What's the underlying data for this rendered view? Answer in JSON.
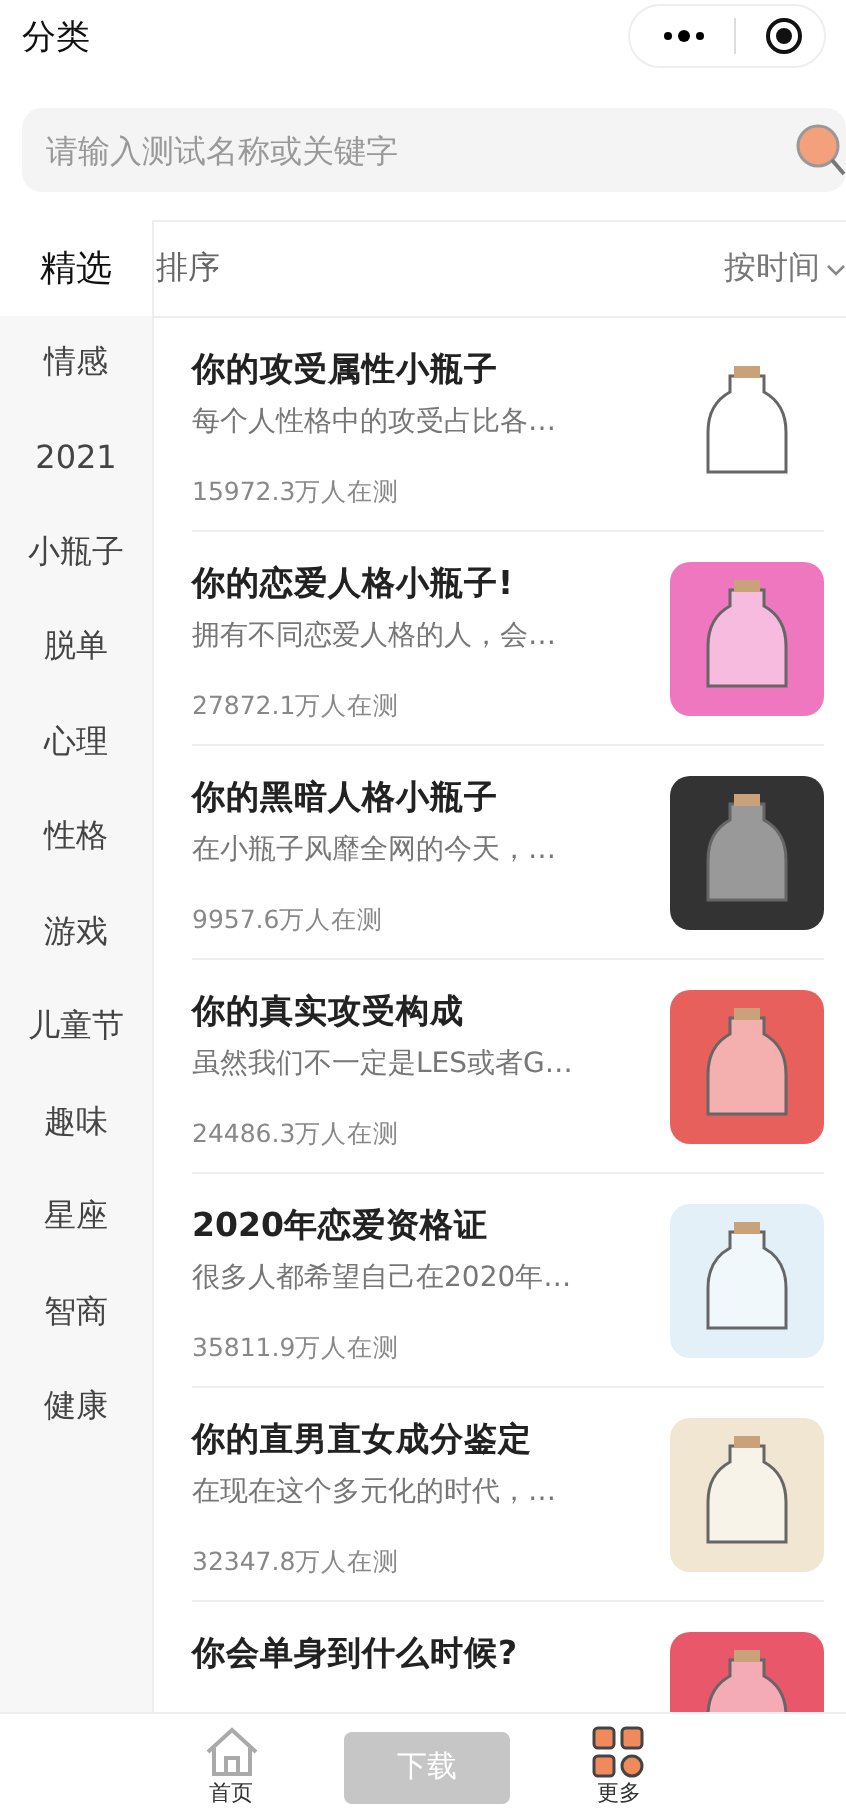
{
  "header": {
    "title": "分类"
  },
  "search": {
    "placeholder": "请输入测试名称或关键字"
  },
  "sidebar": {
    "items": [
      {
        "label": "精选",
        "selected": true
      },
      {
        "label": "情感",
        "selected": false
      },
      {
        "label": "2021",
        "selected": false
      },
      {
        "label": "小瓶子",
        "selected": false
      },
      {
        "label": "脱单",
        "selected": false
      },
      {
        "label": "心理",
        "selected": false
      },
      {
        "label": "性格",
        "selected": false
      },
      {
        "label": "游戏",
        "selected": false
      },
      {
        "label": "儿童节",
        "selected": false
      },
      {
        "label": "趣味",
        "selected": false
      },
      {
        "label": "星座",
        "selected": false
      },
      {
        "label": "智商",
        "selected": false
      },
      {
        "label": "健康",
        "selected": false
      }
    ]
  },
  "sort_bar": {
    "label": "排序",
    "order": "按时间"
  },
  "tests": [
    {
      "title": "你的攻受属性小瓶子",
      "description": "每个人性格中的攻受占比各…",
      "count": "15972.3万人在测"
    },
    {
      "title": "你的恋爱人格小瓶子!",
      "description": "拥有不同恋爱人格的人，会…",
      "count": "27872.1万人在测",
      "color": "#ef77bf"
    },
    {
      "title": "你的黑暗人格小瓶子",
      "description": "在小瓶子风靡全网的今天，…",
      "count": "9957.6万人在测",
      "color": "#333333"
    },
    {
      "title": "你的真实攻受构成",
      "description": "虽然我们不一定是LES或者G…",
      "count": "24486.3万人在测",
      "color": "#e8605c"
    },
    {
      "title": "2020年恋爱资格证",
      "description": "很多人都希望自己在2020年…",
      "count": "35811.9万人在测",
      "color": "#e3f0f8"
    },
    {
      "title": "你的直男直女成分鉴定",
      "description": "在现在这个多元化的时代，…",
      "count": "32347.8万人在测",
      "color": "#f1e6d2"
    },
    {
      "title": "你会单身到什么时候?",
      "color": "#e9576a"
    }
  ],
  "bottom_nav": {
    "home": "首页",
    "download": "下载",
    "more": "更多"
  }
}
